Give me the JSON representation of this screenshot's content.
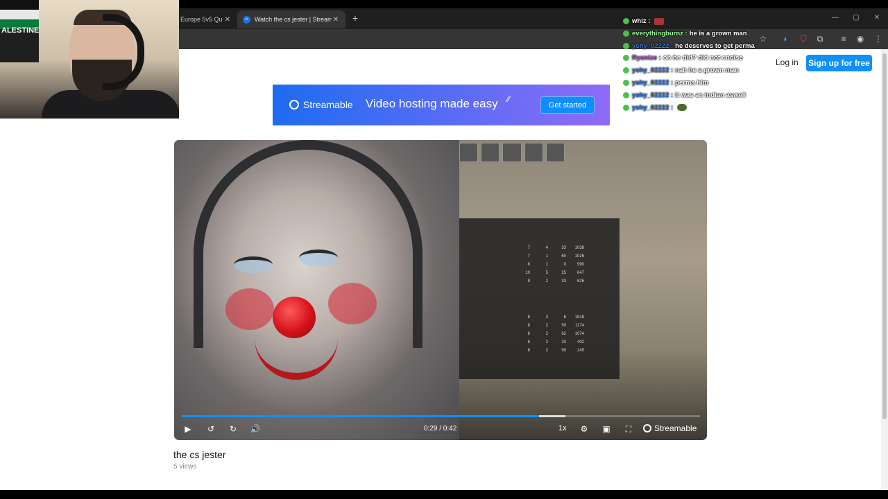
{
  "browser": {
    "tabs": [
      {
        "label": "Europe 5v5 Qu",
        "close": "✕"
      },
      {
        "label": "Watch the cs jester | Streamable",
        "close": "✕"
      }
    ],
    "new_tab": "+",
    "window_controls": [
      "—",
      "▢",
      "✕"
    ]
  },
  "header": {
    "login_label": "Log in",
    "signup_label": "Sign up for free"
  },
  "banner": {
    "brand": "Streamable",
    "tagline": "Video hosting made easy",
    "cta_label": "Get started"
  },
  "player": {
    "time_display": "0:29 / 0:42",
    "progress_fraction": 0.69,
    "buffered_fraction": 0.74,
    "speed_label": "1x",
    "brand": "Streamable",
    "accent_color": "#0f90fa"
  },
  "video": {
    "title": "the cs jester",
    "views": "5 views"
  },
  "webcam": {
    "poster_text": "ALESTINE"
  },
  "chat": [
    {
      "user": "whiz",
      "color": "#ffffff",
      "message": "",
      "emote": "red"
    },
    {
      "user": "everythingburnz",
      "color": "#9dfc9d",
      "message": "he is a grown man",
      "emote": ""
    },
    {
      "user": "yshy_02222",
      "color": "#3a7bd5",
      "message": "he deserves to get perma",
      "emote": ""
    },
    {
      "user": "Ryanize",
      "color": "#b05ad8",
      "message": "oh he did? did not cnoise",
      "emote": ""
    },
    {
      "user": "yshy_02222",
      "color": "#3a7bd5",
      "message": "nah he a grown man",
      "emote": ""
    },
    {
      "user": "yshy_02222",
      "color": "#3a7bd5",
      "message": "perma him",
      "emote": ""
    },
    {
      "user": "yshy_02222",
      "color": "#3a7bd5",
      "message": "it was an indian aswell",
      "emote": ""
    },
    {
      "user": "yshy_02222",
      "color": "#3a7bd5",
      "message": "",
      "emote": "green"
    }
  ]
}
